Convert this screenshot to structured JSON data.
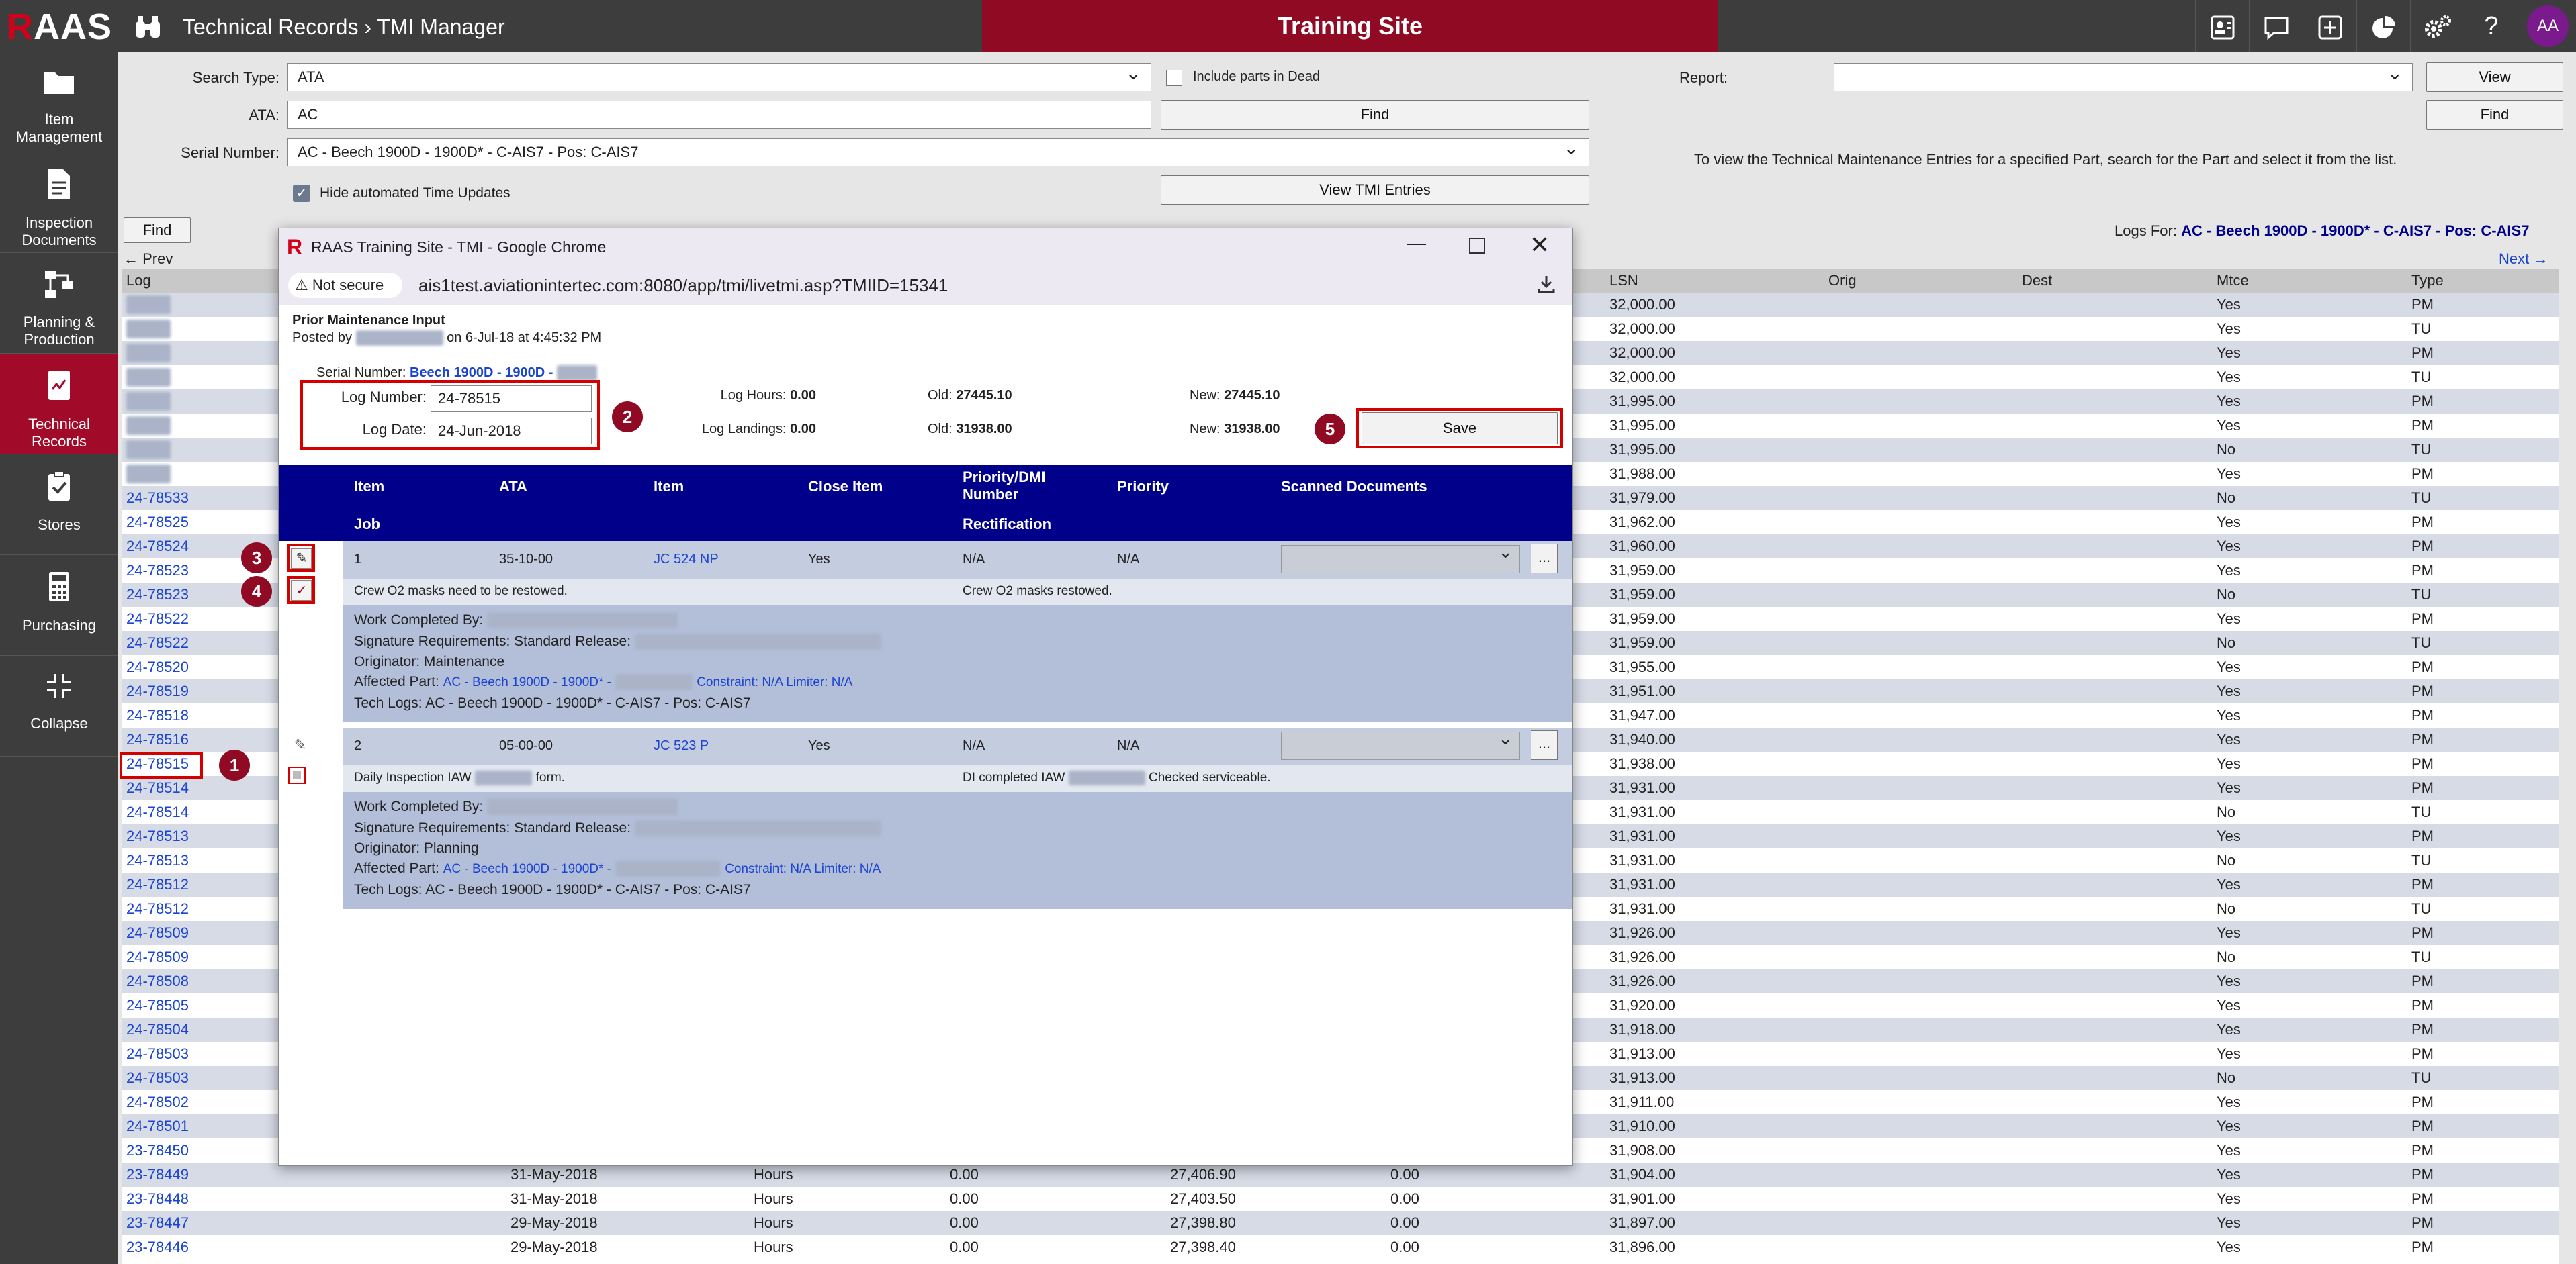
{
  "app": {
    "logo_r": "R",
    "logo_rest": "AAS",
    "breadcrumb": "Technical Records › TMI Manager",
    "site_banner": "Training Site",
    "avatar_initials": "AA"
  },
  "topbar_icons": [
    "id-card-icon",
    "chat-icon",
    "plus-square-icon",
    "pie-chart-icon",
    "gear-icon",
    "help-icon"
  ],
  "sidebar": {
    "items": [
      {
        "label": "Item Management",
        "icon": "folder-icon"
      },
      {
        "label": "Inspection Documents",
        "icon": "document-icon"
      },
      {
        "label": "Planning & Production",
        "icon": "workflow-icon"
      },
      {
        "label": "Technical Records",
        "icon": "records-icon",
        "active": true
      },
      {
        "label": "Stores",
        "icon": "clipboard-check-icon"
      },
      {
        "label": "Purchasing",
        "icon": "calculator-icon"
      },
      {
        "label": "Collapse",
        "icon": "collapse-icon"
      }
    ]
  },
  "search": {
    "search_type_label": "Search Type:",
    "search_type_value": "ATA",
    "include_dead_label": "Include parts in Dead",
    "ata_label": "ATA:",
    "ata_value": "AC",
    "find_label": "Find",
    "serial_label": "Serial Number:",
    "serial_value": "AC - Beech 1900D - 1900D* - C-AIS7 - Pos: C-AIS7",
    "hide_auto_label": "Hide automated Time Updates",
    "view_tmi_label": "View TMI Entries",
    "report_label": "Report:",
    "view_label": "View",
    "find2_label": "Find",
    "hint": "To view the Technical Maintenance Entries for a specified Part, search for the Part and select it from the list.",
    "find3_label": "Find",
    "logs_for_label": "Logs For:",
    "logs_for_value": "AC - Beech 1900D - 1900D* - C-AIS7 - Pos: C-AIS7",
    "prev": "← Prev",
    "next": "Next →"
  },
  "log_table": {
    "headers": {
      "log": "Log",
      "lsn": "LSN",
      "orig": "Orig",
      "dest": "Dest",
      "mtce": "Mtce",
      "type": "Type"
    },
    "rows": [
      {
        "log": "",
        "date": "",
        "unit": "",
        "v1": "",
        "hours": "",
        "v2": "",
        "lsn": "32,000.00",
        "mtce": "Yes",
        "type": "PM",
        "blur": true
      },
      {
        "log": "",
        "date": "",
        "unit": "",
        "v1": "",
        "hours": "",
        "v2": "",
        "lsn": "32,000.00",
        "mtce": "Yes",
        "type": "TU",
        "blur": true
      },
      {
        "log": "",
        "date": "",
        "unit": "",
        "v1": "",
        "hours": "",
        "v2": "",
        "lsn": "32,000.00",
        "mtce": "Yes",
        "type": "PM",
        "blur": true
      },
      {
        "log": "",
        "date": "",
        "unit": "",
        "v1": "",
        "hours": "",
        "v2": "",
        "lsn": "32,000.00",
        "mtce": "Yes",
        "type": "TU",
        "blur": true
      },
      {
        "log": "",
        "date": "",
        "unit": "",
        "v1": "",
        "hours": "",
        "v2": "",
        "lsn": "31,995.00",
        "mtce": "Yes",
        "type": "PM",
        "blur": true
      },
      {
        "log": "",
        "date": "",
        "unit": "",
        "v1": "",
        "hours": "",
        "v2": "",
        "lsn": "31,995.00",
        "mtce": "Yes",
        "type": "PM",
        "blur": true
      },
      {
        "log": "",
        "date": "",
        "unit": "",
        "v1": "",
        "hours": "",
        "v2": "",
        "lsn": "31,995.00",
        "mtce": "No",
        "type": "TU",
        "blur": true
      },
      {
        "log": "",
        "date": "",
        "unit": "",
        "v1": "",
        "hours": "",
        "v2": "",
        "lsn": "31,988.00",
        "mtce": "Yes",
        "type": "PM",
        "blur": true
      },
      {
        "log": "24-78533",
        "date": "",
        "unit": "",
        "v1": "",
        "hours": "",
        "v2": "",
        "lsn": "31,979.00",
        "mtce": "No",
        "type": "TU"
      },
      {
        "log": "24-78525",
        "date": "",
        "unit": "",
        "v1": "",
        "hours": "",
        "v2": "",
        "lsn": "31,962.00",
        "mtce": "Yes",
        "type": "PM"
      },
      {
        "log": "24-78524",
        "date": "",
        "unit": "",
        "v1": "",
        "hours": "",
        "v2": "",
        "lsn": "31,960.00",
        "mtce": "Yes",
        "type": "PM"
      },
      {
        "log": "24-78523",
        "date": "",
        "unit": "",
        "v1": "",
        "hours": "",
        "v2": "",
        "lsn": "31,959.00",
        "mtce": "Yes",
        "type": "PM"
      },
      {
        "log": "24-78523",
        "date": "",
        "unit": "",
        "v1": "",
        "hours": "",
        "v2": "",
        "lsn": "31,959.00",
        "mtce": "No",
        "type": "TU"
      },
      {
        "log": "24-78522",
        "date": "",
        "unit": "",
        "v1": "",
        "hours": "",
        "v2": "",
        "lsn": "31,959.00",
        "mtce": "Yes",
        "type": "PM"
      },
      {
        "log": "24-78522",
        "date": "",
        "unit": "",
        "v1": "",
        "hours": "",
        "v2": "",
        "lsn": "31,959.00",
        "mtce": "No",
        "type": "TU"
      },
      {
        "log": "24-78520",
        "date": "",
        "unit": "",
        "v1": "",
        "hours": "",
        "v2": "",
        "lsn": "31,955.00",
        "mtce": "Yes",
        "type": "PM"
      },
      {
        "log": "24-78519",
        "date": "",
        "unit": "",
        "v1": "",
        "hours": "",
        "v2": "",
        "lsn": "31,951.00",
        "mtce": "Yes",
        "type": "PM"
      },
      {
        "log": "24-78518",
        "date": "",
        "unit": "",
        "v1": "",
        "hours": "",
        "v2": "",
        "lsn": "31,947.00",
        "mtce": "Yes",
        "type": "PM"
      },
      {
        "log": "24-78516",
        "date": "",
        "unit": "",
        "v1": "",
        "hours": "",
        "v2": "",
        "lsn": "31,940.00",
        "mtce": "Yes",
        "type": "PM"
      },
      {
        "log": "24-78515",
        "date": "",
        "unit": "",
        "v1": "",
        "hours": "",
        "v2": "",
        "lsn": "31,938.00",
        "mtce": "Yes",
        "type": "PM",
        "highlight": true
      },
      {
        "log": "24-78514",
        "date": "",
        "unit": "",
        "v1": "",
        "hours": "",
        "v2": "",
        "lsn": "31,931.00",
        "mtce": "Yes",
        "type": "PM"
      },
      {
        "log": "24-78514",
        "date": "",
        "unit": "",
        "v1": "",
        "hours": "",
        "v2": "",
        "lsn": "31,931.00",
        "mtce": "No",
        "type": "TU"
      },
      {
        "log": "24-78513",
        "date": "",
        "unit": "",
        "v1": "",
        "hours": "",
        "v2": "",
        "lsn": "31,931.00",
        "mtce": "Yes",
        "type": "PM"
      },
      {
        "log": "24-78513",
        "date": "",
        "unit": "",
        "v1": "",
        "hours": "",
        "v2": "",
        "lsn": "31,931.00",
        "mtce": "No",
        "type": "TU"
      },
      {
        "log": "24-78512",
        "date": "",
        "unit": "",
        "v1": "",
        "hours": "",
        "v2": "",
        "lsn": "31,931.00",
        "mtce": "Yes",
        "type": "PM"
      },
      {
        "log": "24-78512",
        "date": "",
        "unit": "",
        "v1": "",
        "hours": "",
        "v2": "",
        "lsn": "31,931.00",
        "mtce": "No",
        "type": "TU"
      },
      {
        "log": "24-78509",
        "date": "",
        "unit": "",
        "v1": "",
        "hours": "",
        "v2": "",
        "lsn": "31,926.00",
        "mtce": "Yes",
        "type": "PM"
      },
      {
        "log": "24-78509",
        "date": "",
        "unit": "",
        "v1": "",
        "hours": "",
        "v2": "",
        "lsn": "31,926.00",
        "mtce": "No",
        "type": "TU"
      },
      {
        "log": "24-78508",
        "date": "",
        "unit": "",
        "v1": "",
        "hours": "",
        "v2": "",
        "lsn": "31,926.00",
        "mtce": "Yes",
        "type": "PM"
      },
      {
        "log": "24-78505",
        "date": "",
        "unit": "",
        "v1": "",
        "hours": "",
        "v2": "",
        "lsn": "31,920.00",
        "mtce": "Yes",
        "type": "PM"
      },
      {
        "log": "24-78504",
        "date": "",
        "unit": "",
        "v1": "",
        "hours": "",
        "v2": "",
        "lsn": "31,918.00",
        "mtce": "Yes",
        "type": "PM"
      },
      {
        "log": "24-78503",
        "date": "",
        "unit": "",
        "v1": "",
        "hours": "",
        "v2": "",
        "lsn": "31,913.00",
        "mtce": "Yes",
        "type": "PM"
      },
      {
        "log": "24-78503",
        "date": "",
        "unit": "",
        "v1": "",
        "hours": "",
        "v2": "",
        "lsn": "31,913.00",
        "mtce": "No",
        "type": "TU"
      },
      {
        "log": "24-78502",
        "date": "",
        "unit": "",
        "v1": "",
        "hours": "",
        "v2": "",
        "lsn": "31,911.00",
        "mtce": "Yes",
        "type": "PM"
      },
      {
        "log": "24-78501",
        "date": "",
        "unit": "",
        "v1": "",
        "hours": "",
        "v2": "",
        "lsn": "31,910.00",
        "mtce": "Yes",
        "type": "PM"
      },
      {
        "log": "23-78450",
        "date": "",
        "unit": "",
        "v1": "",
        "hours": "",
        "v2": "",
        "lsn": "31,908.00",
        "mtce": "Yes",
        "type": "PM"
      },
      {
        "log": "23-78449",
        "date": "31-May-2018",
        "unit": "Hours",
        "v1": "0.00",
        "hours": "27,406.90",
        "v2": "0.00",
        "lsn": "31,904.00",
        "mtce": "Yes",
        "type": "PM"
      },
      {
        "log": "23-78448",
        "date": "31-May-2018",
        "unit": "Hours",
        "v1": "0.00",
        "hours": "27,403.50",
        "v2": "0.00",
        "lsn": "31,901.00",
        "mtce": "Yes",
        "type": "PM"
      },
      {
        "log": "23-78447",
        "date": "29-May-2018",
        "unit": "Hours",
        "v1": "0.00",
        "hours": "27,398.80",
        "v2": "0.00",
        "lsn": "31,897.00",
        "mtce": "Yes",
        "type": "PM"
      },
      {
        "log": "23-78446",
        "date": "29-May-2018",
        "unit": "Hours",
        "v1": "0.00",
        "hours": "27,398.40",
        "v2": "0.00",
        "lsn": "31,896.00",
        "mtce": "Yes",
        "type": "PM"
      }
    ]
  },
  "popup": {
    "window_title": "RAAS Training Site - TMI - Google Chrome",
    "not_secure": "Not secure",
    "url": "ais1test.aviationintertec.com:8080/app/tmi/livetmi.asp?TMIID=15341",
    "section_title": "Prior Maintenance Input",
    "posted_by_prefix": "Posted by",
    "posted_by_suffix": "on 6-Jul-18 at 4:45:32 PM",
    "serial_label": "Serial Number:",
    "serial_value": "Beech 1900D - 1900D -",
    "log_number_label": "Log Number:",
    "log_number_value": "24-78515",
    "log_date_label": "Log Date:",
    "log_date_value": "24-Jun-2018",
    "log_hours_label": "Log Hours:",
    "log_hours_value": "0.00",
    "log_landings_label": "Log Landings:",
    "log_landings_value": "0.00",
    "old_label": "Old:",
    "old_hours": "27445.10",
    "old_landings": "31938.00",
    "new_label": "New:",
    "new_hours": "27445.10",
    "new_landings": "31938.00",
    "save_label": "Save",
    "headers": {
      "item": "Item",
      "ata": "ATA",
      "item2": "Item",
      "close_item": "Close Item",
      "priority_dmi": "Priority/DMI Number",
      "priority": "Priority",
      "scanned": "Scanned Documents",
      "job": "Job",
      "rectification": "Rectification"
    },
    "items": [
      {
        "num": "1",
        "ata": "35-10-00",
        "jc": "JC 524 NP",
        "close": "Yes",
        "pdmi": "N/A",
        "priority": "N/A",
        "job": "Crew O2 masks need to be restowed.",
        "rect": "Crew O2 masks restowed.",
        "work_label": "Work Completed By:",
        "sig_label": "Signature Requirements: Standard Release:",
        "orig_label": "Originator:",
        "orig_value": "Maintenance",
        "aff_label": "Affected Part:",
        "aff_value": "AC - Beech 1900D - 1900D* -",
        "aff_tail": "Constraint: N/A Limiter: N/A",
        "tech_logs": "Tech Logs: AC - Beech 1900D - 1900D* - C-AIS7 - Pos: C-AIS7"
      },
      {
        "num": "2",
        "ata": "05-00-00",
        "jc": "JC 523 P",
        "close": "Yes",
        "pdmi": "N/A",
        "priority": "N/A",
        "job_prefix": "Daily Inspection IAW",
        "job_suffix": "form.",
        "rect_prefix": "DI completed IAW",
        "rect_suffix": "Checked serviceable.",
        "work_label": "Work Completed By:",
        "sig_label": "Signature Requirements: Standard Release:",
        "orig_label": "Originator:",
        "orig_value": "Planning",
        "aff_label": "Affected Part:",
        "aff_value": "AC - Beech 1900D - 1900D* -",
        "aff_tail": "Constraint: N/A Limiter: N/A",
        "tech_logs": "Tech Logs: AC - Beech 1900D - 1900D* - C-AIS7 - Pos: C-AIS7"
      }
    ],
    "scan_more": "..."
  },
  "annotations": {
    "b1": "1",
    "b2": "2",
    "b3": "3",
    "b4": "4",
    "b5": "5"
  },
  "colors": {
    "brand_red": "#8f0a22",
    "nav_dark": "#3d3d3d",
    "table_header_blue": "#00008b",
    "link_blue": "#1a44d1",
    "highlight_red": "#d40000"
  }
}
